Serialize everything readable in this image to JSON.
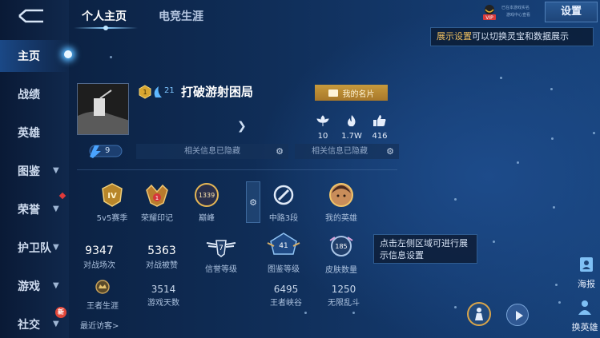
{
  "sidebar": {
    "items": [
      {
        "label": "主页"
      },
      {
        "label": "战绩"
      },
      {
        "label": "英雄"
      },
      {
        "label": "图鉴"
      },
      {
        "label": "荣誉"
      },
      {
        "label": "护卫队"
      },
      {
        "label": "游戏"
      },
      {
        "label": "社交"
      }
    ],
    "new_badge": "新"
  },
  "tabs": [
    {
      "label": "个人主页"
    },
    {
      "label": "电竞生涯"
    }
  ],
  "top_right": {
    "vip_label": "VIP",
    "notice_line1": "已在本游戏实名",
    "notice_line2": "游戏中心查看",
    "settings_label": "设置",
    "settings_tip_prefix": "展示设置",
    "settings_tip_rest": "可以切换灵宝和数据展示"
  },
  "profile": {
    "rank_num": "21",
    "name": "打破游射困局",
    "card_button": "我的名片",
    "level": "9",
    "stats": [
      {
        "icon": "flower-icon",
        "value": "10"
      },
      {
        "icon": "fire-icon",
        "value": "1.7W"
      },
      {
        "icon": "thumbs-up-icon",
        "value": "416"
      }
    ],
    "hidden_1": "相关信息已隐藏",
    "hidden_2": "相关信息已隐藏"
  },
  "honors": [
    {
      "icon": "season-rank-icon",
      "label": "5v5赛季",
      "badge": "IV"
    },
    {
      "icon": "honor-mark-icon",
      "label": "荣耀印记",
      "badge": "1"
    },
    {
      "icon": "peak-icon",
      "label": "巅峰",
      "badge": "1339"
    },
    {
      "icon": "lane-icon",
      "label": "中路3段"
    },
    {
      "icon": "hero-portrait-icon",
      "label": "我的英雄"
    }
  ],
  "stats_row1": [
    {
      "value": "9347",
      "label": "对战场次"
    },
    {
      "value": "5363",
      "label": "对战被赞"
    }
  ],
  "stats_row1_icons": [
    {
      "icon": "credit-icon",
      "label": "信誉等级",
      "badge": "7"
    },
    {
      "icon": "codex-icon",
      "label": "图鉴等级",
      "badge": "41"
    },
    {
      "icon": "skin-icon",
      "label": "皮肤数量",
      "badge": "185"
    }
  ],
  "stats_row2": [
    {
      "icon": "king-icon",
      "label": "王者生涯"
    },
    {
      "value": "3514",
      "label": "游戏天数"
    },
    {
      "value": "6495",
      "label": "王者峡谷"
    },
    {
      "value": "1250",
      "label": "无限乱斗"
    }
  ],
  "info_tip": "点击左侧区域可进行展示信息设置",
  "recent_visitors": "最近访客>",
  "right_buttons": {
    "poster": "海报",
    "change_hero": "换英雄"
  }
}
